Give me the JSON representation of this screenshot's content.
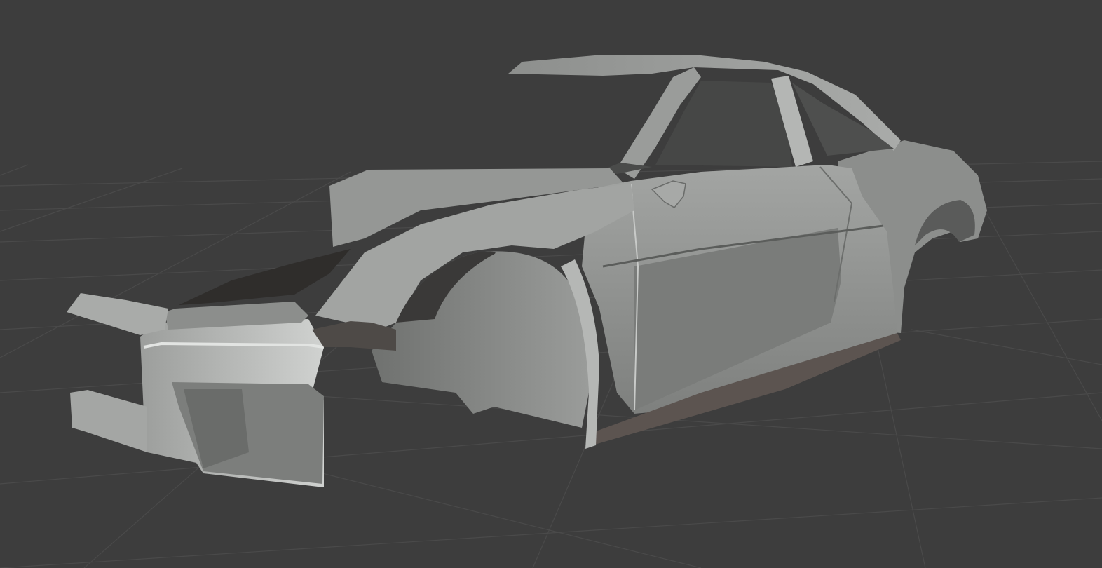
{
  "viewport": {
    "background_color": "#3d3d3d",
    "grid_color": "#4a4a4a",
    "shading_mode": "solid"
  },
  "model": {
    "base_color": "#8a8b8a",
    "shadow_color": "#2e2c2a",
    "highlight_color": "#c9cbc9"
  }
}
